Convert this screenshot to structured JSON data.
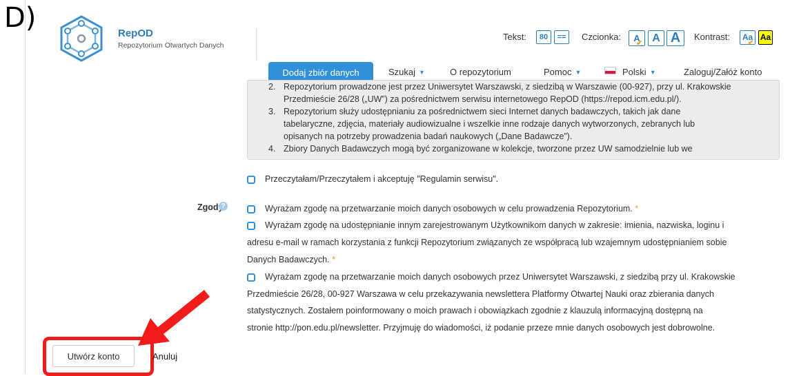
{
  "annotation": {
    "panel_letter": "D)"
  },
  "colors": {
    "brand": "#2e7dba",
    "primary_button": "#3190d8",
    "checkbox_border": "#3190d8",
    "required_star": "#f0a020",
    "highlight_red": "#f21b1b",
    "reg_box_bg": "#ececec",
    "contrast_yellow": "#ffff00"
  },
  "header": {
    "logo_icon": "hexagon-network-icon",
    "brand_name": "RepOD",
    "brand_subtitle": "Repozytorium Otwartych Danych",
    "accessibility": {
      "text_label": "Tekst:",
      "text_size_80": "80",
      "text_size_eq": "==",
      "font_label": "Czcionka:",
      "font_btn_small": "A",
      "font_btn_medium": "A",
      "font_btn_large": "A",
      "contrast_label": "Kontrast:",
      "contrast_btn_normal": "Aa",
      "contrast_btn_high": "Aa"
    }
  },
  "nav": {
    "add_dataset": "Dodaj zbiór danych",
    "search": "Szukaj",
    "about": "O repozytorium",
    "help": "Pomoc",
    "language": "Polski",
    "login": "Zaloguj/Załóż konto",
    "caret_icon": "caret-down-icon",
    "flag_icon": "poland-flag-icon"
  },
  "regulations": {
    "items": [
      {
        "num": "2.",
        "lines": [
          "Repozytorium prowadzone jest przez Uniwersytet Warszawski, z siedzibą w Warszawie (00-927), przy ul. Krakowskie",
          "Przedmieście 26/28 („UW”) za pośrednictwem serwisu internetowego RepOD (https://repod.icm.edu.pl/)."
        ]
      },
      {
        "num": "3.",
        "lines": [
          "Repozytorium służy udostępnianiu za pośrednictwem sieci Internet danych badawczych, takich jak dane",
          "tabelaryczne, zdjęcia, materiały audiowizualne i wszelkie inne rodzaje danych wytworzonych, zebranych lub",
          "opisanych na potrzeby prowadzenia badań naukowych („Dane Badawcze”)."
        ]
      },
      {
        "num": "4.",
        "lines": [
          "Zbiory Danych Badawczych mogą być zorganizowane w kolekcje, tworzone przez UW samodzielnie lub we"
        ]
      }
    ]
  },
  "terms_checkbox": {
    "label": "Przeczytałam/Przeczytałem i akceptuję \"Regulamin serwisu\"."
  },
  "consents": {
    "label": "Zgody",
    "help_icon": "question-circle-icon",
    "required_mark": "*",
    "c1_text": "Wyrażam zgodę na przetwarzanie moich danych osobowych w celu prowadzenia Repozytorium.",
    "c2_line1": "Wyrażam zgodę na udostępnianie innym zarejestrowanym Użytkownikom danych w zakresie: imienia, nazwiska, loginu i",
    "c2_line2": "adresu e-mail w ramach korzystania z funkcji Repozytorium związanych ze współpracą lub wzajemnym udostępnianiem sobie",
    "c2_line3": "Danych Badawczych.",
    "c3_line1": "Wyrażam zgodę na przetwarzanie moich danych osobowych przez Uniwersytet Warszawski, z siedzibą przy ul. Krakowskie",
    "c3_line2": "Przedmieście 26/28, 00-927 Warszawa w celu przekazywania newslettera Platformy Otwartej Nauki oraz zbierania danych",
    "c3_line3": "statystycznych. Zostałem poinformowany o moich prawach i obowiązkach zgodnie z klauzulą informacyjną dostępną na",
    "c3_line4": "stronie http://pon.edu.pl/newsletter. Przyjmuję do wiadomości, iż podanie przeze mnie danych osobowych jest dobrowolne."
  },
  "actions": {
    "create_account": "Utwórz konto",
    "cancel": "Anuluj"
  }
}
